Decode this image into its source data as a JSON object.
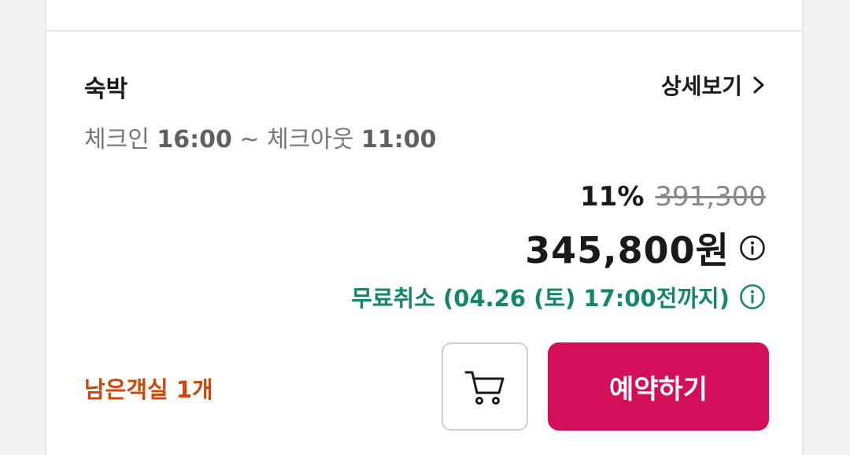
{
  "stay": {
    "title": "숙박",
    "detail_label": "상세보기",
    "checkin_label": "체크인",
    "checkin_time": "16:00",
    "separator": "~",
    "checkout_label": "체크아웃",
    "checkout_time": "11:00"
  },
  "pricing": {
    "discount": "11%",
    "original_price": "391,300",
    "final_price": "345,800원",
    "free_cancel": "무료취소 (04.26 (토) 17:00전까지)"
  },
  "availability": {
    "rooms_left": "남은객실 1개"
  },
  "actions": {
    "book_label": "예약하기"
  },
  "icons": {
    "detail": "chevron-right-icon",
    "price_info": "info-icon",
    "cancel_info": "info-icon",
    "cart": "cart-icon"
  },
  "colors": {
    "brand": "#d30f59",
    "free_cancel": "#14876a",
    "rooms_left": "#c8480d"
  }
}
